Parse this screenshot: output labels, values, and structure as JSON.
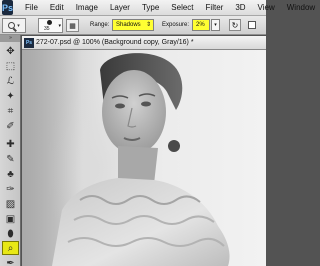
{
  "app": {
    "logo": "Ps",
    "menu": [
      "File",
      "Edit",
      "Image",
      "Layer",
      "Type",
      "Select",
      "Filter",
      "3D",
      "View",
      "Window"
    ]
  },
  "options": {
    "brush_size": "35",
    "range_label": "Range:",
    "range_value": "Shadows",
    "exposure_label": "Exposure:",
    "exposure_value": "2%",
    "highlight_color": "#ffff33"
  },
  "document": {
    "title": "272-07.psd @ 100% (Background copy, Gray/16) *"
  },
  "tools": [
    {
      "name": "move-tool-icon",
      "glyph": "✥"
    },
    {
      "name": "marquee-tool-icon",
      "glyph": "⬚"
    },
    {
      "name": "lasso-tool-icon",
      "glyph": "ℒ"
    },
    {
      "name": "quick-select-tool-icon",
      "glyph": "✦"
    },
    {
      "name": "crop-tool-icon",
      "glyph": "⌗"
    },
    {
      "name": "eyedropper-tool-icon",
      "glyph": "✐"
    },
    {
      "name": "healing-brush-tool-icon",
      "glyph": "✚"
    },
    {
      "name": "brush-tool-icon",
      "glyph": "✎"
    },
    {
      "name": "clone-stamp-tool-icon",
      "glyph": "♣"
    },
    {
      "name": "history-brush-tool-icon",
      "glyph": "✑"
    },
    {
      "name": "eraser-tool-icon",
      "glyph": "▨"
    },
    {
      "name": "gradient-tool-icon",
      "glyph": "▣"
    },
    {
      "name": "blur-tool-icon",
      "glyph": "⬮"
    },
    {
      "name": "burn-tool-icon",
      "glyph": "⌕"
    },
    {
      "name": "pen-tool-icon",
      "glyph": "✒"
    }
  ]
}
